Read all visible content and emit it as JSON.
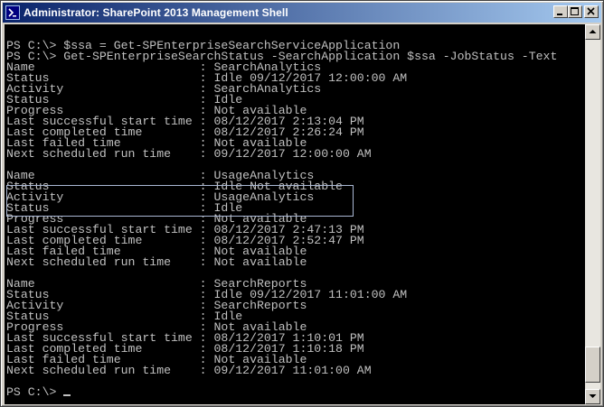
{
  "window": {
    "title": "Administrator: SharePoint 2013 Management Shell",
    "title_bar_colors": [
      "#0a246a",
      "#a6caf0"
    ],
    "icons": {
      "app": "powershell-icon",
      "minimize": "minimize-icon",
      "maximize": "maximize-icon",
      "close": "close-icon"
    }
  },
  "console": {
    "background": "#000000",
    "foreground": "#c0c0c0",
    "lines": [
      "PS C:\\> $ssa = Get-SPEnterpriseSearchServiceApplication",
      "PS C:\\> Get-SPEnterpriseSearchStatus -SearchApplication $ssa -JobStatus -Text",
      "Name                       : SearchAnalytics",
      "Status                     : Idle 09/12/2017 12:00:00 AM",
      "Activity                   : SearchAnalytics",
      "Status                     : Idle",
      "Progress                   : Not available",
      "Last successful start time : 08/12/2017 2:13:04 PM",
      "Last completed time        : 08/12/2017 2:26:24 PM",
      "Last failed time           : Not available",
      "Next scheduled run time    : 09/12/2017 12:00:00 AM",
      "",
      "Name                       : UsageAnalytics",
      "Status                     : Idle Not available",
      "Activity                   : UsageAnalytics",
      "Status                     : Idle",
      "Progress                   : Not available",
      "Last successful start time : 08/12/2017 2:47:13 PM",
      "Last completed time        : 08/12/2017 2:52:47 PM",
      "Last failed time           : Not available",
      "Next scheduled run time    : Not available",
      "",
      "Name                       : SearchReports",
      "Status                     : Idle 09/12/2017 11:01:00 AM",
      "Activity                   : SearchReports",
      "Status                     : Idle",
      "Progress                   : Not available",
      "Last successful start time : 08/12/2017 1:10:01 PM",
      "Last completed time        : 08/12/2017 1:10:18 PM",
      "Last failed time           : Not available",
      "Next scheduled run time    : 09/12/2017 11:01:00 AM",
      "",
      "PS C:\\> "
    ]
  },
  "scrollbar": {
    "position": 0.98
  }
}
